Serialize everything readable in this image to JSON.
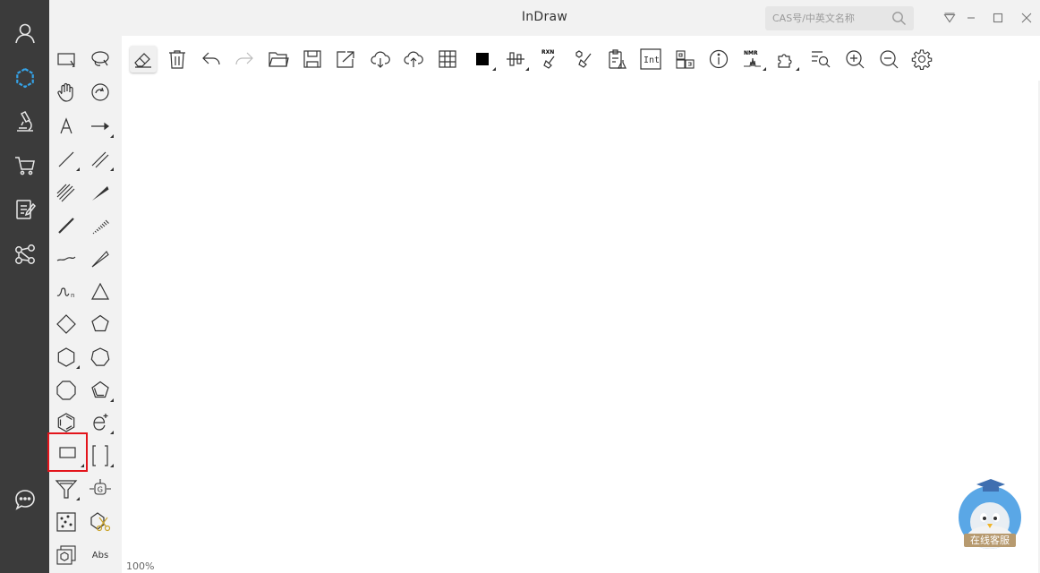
{
  "window": {
    "title": "InDraw"
  },
  "search": {
    "placeholder": "CAS号/中英文名称"
  },
  "status": {
    "zoom": "100%"
  },
  "support": {
    "label": "在线客服"
  },
  "palette": {
    "abs_label": "Abs"
  },
  "colors": {
    "rail_bg": "#3b3b3b",
    "rail_active_icon": "#35a3e8",
    "selected_outline": "#e3141b",
    "canvas_bg": "#ffffff"
  },
  "rail_items": [
    "user-icon",
    "indraw-logo-icon",
    "microscope-icon",
    "cart-icon",
    "notes-icon",
    "share-icon",
    "chat-icon"
  ],
  "toolbar_items": [
    "eraser-icon",
    "trash-icon",
    "undo-icon",
    "redo-icon",
    "open-folder-icon",
    "save-icon",
    "export-icon",
    "cloud-download-icon",
    "cloud-upload-icon",
    "grid-icon",
    "color-icon",
    "align-icon",
    "rxn-clean-icon",
    "clean-icon",
    "clipboard-flask-icon",
    "int-icon",
    "template-icon",
    "info-icon",
    "nmr-icon",
    "puzzle-icon",
    "search-list-icon",
    "zoom-in-icon",
    "zoom-out-icon",
    "settings-icon"
  ]
}
